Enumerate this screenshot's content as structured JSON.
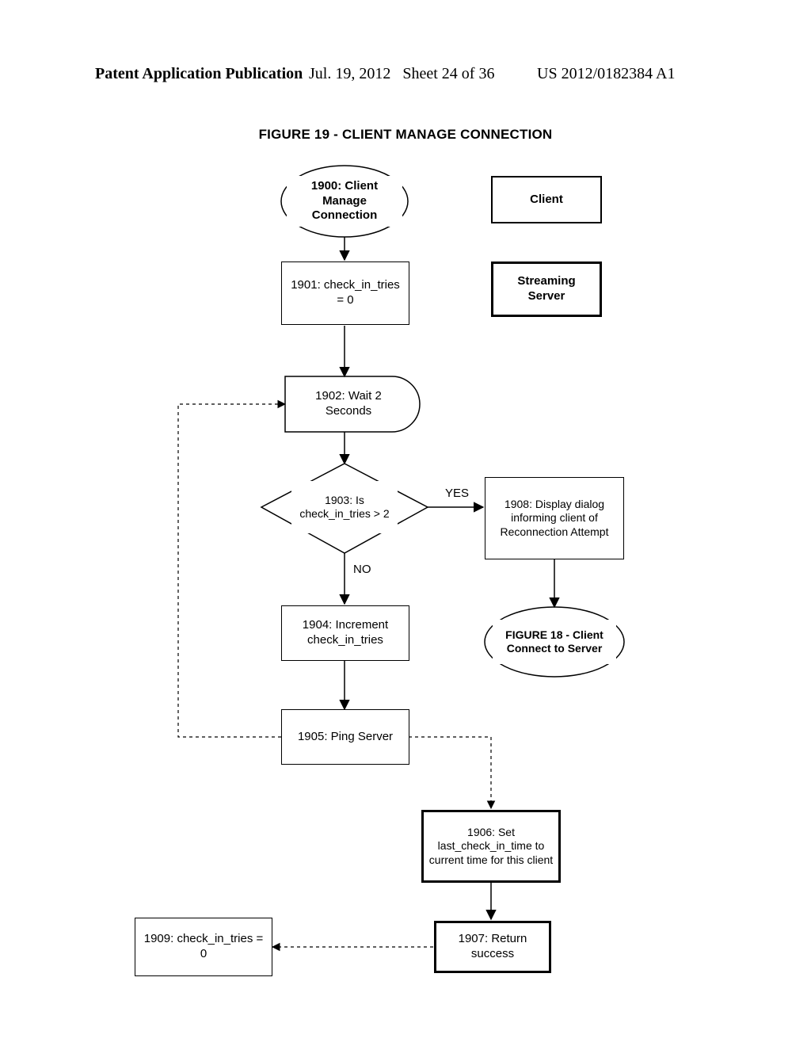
{
  "header": {
    "pub_label": "Patent Application Publication",
    "date": "Jul. 19, 2012",
    "sheet": "Sheet 24 of 36",
    "pubnum": "US 2012/0182384 A1"
  },
  "figtitle": "FIGURE 19 - CLIENT MANAGE CONNECTION",
  "legend": {
    "client": "Client",
    "server": "Streaming Server"
  },
  "steps": {
    "s1900": "1900: Client Manage Connection",
    "s1901": "1901: check_in_tries = 0",
    "s1902": "1902: Wait 2 Seconds",
    "s1903": "1903: Is check_in_tries > 2",
    "s1904": "1904: Increment check_in_tries",
    "s1905": "1905: Ping Server",
    "s1906": "1906: Set last_check_in_time to current time for this client",
    "s1907": "1907: Return success",
    "s1908": "1908: Display dialog informing client of Reconnection Attempt",
    "s1909": "1909: check_in_tries = 0",
    "fig18": "FIGURE 18 - Client Connect to Server"
  },
  "branches": {
    "yes": "YES",
    "no": "NO"
  }
}
